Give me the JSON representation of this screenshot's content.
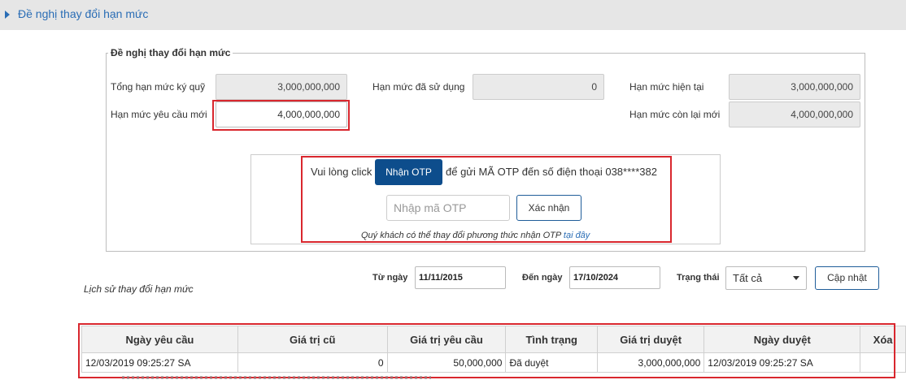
{
  "page_header": {
    "title": "Đề nghị thay đổi hạn mức"
  },
  "form": {
    "legend": "Đề nghị thay đổi hạn mức",
    "total_deposit_limit": {
      "label": "Tổng hạn mức ký quỹ",
      "value": "3,000,000,000"
    },
    "used_limit": {
      "label": "Hạn mức đã sử dụng",
      "value": "0"
    },
    "current_limit": {
      "label": "Hạn mức hiện tại",
      "value": "3,000,000,000"
    },
    "requested_limit": {
      "label": "Hạn mức yêu cầu mới",
      "value": "4,000,000,000"
    },
    "remaining_limit": {
      "label": "Hạn mức còn lại mới",
      "value": "4,000,000,000"
    }
  },
  "otp": {
    "prefix": "Vui lòng click",
    "button": "Nhận OTP",
    "suffix": "để gửi MÃ OTP đến số điện thoại 038****382",
    "input_placeholder": "Nhập mã OTP",
    "confirm_button": "Xác nhận",
    "hint": "Quý khách có thể thay đổi phương thức nhận OTP",
    "hint_link": "tại đây"
  },
  "history": {
    "title": "Lịch sử thay đổi hạn mức",
    "from_label": "Từ ngày",
    "from_value": "11/11/2015",
    "to_label": "Đến ngày",
    "to_value": "17/10/2024",
    "status_label": "Trạng thái",
    "status_value": "Tất cả",
    "update_button": "Cập nhật"
  },
  "table": {
    "columns": [
      "Ngày yêu cầu",
      "Giá trị cũ",
      "Giá trị yêu cầu",
      "Tình trạng",
      "Giá trị duyệt",
      "Ngày duyệt",
      "Xóa"
    ],
    "rows": [
      [
        "12/03/2019 09:25:27 SA",
        "0",
        "50,000,000",
        "Đã duyệt",
        "3,000,000,000",
        "12/03/2019 09:25:27 SA",
        ""
      ]
    ]
  },
  "colors": {
    "accent": "#0d4d8c",
    "link": "#2a6db5",
    "highlight": "#d9272e"
  }
}
